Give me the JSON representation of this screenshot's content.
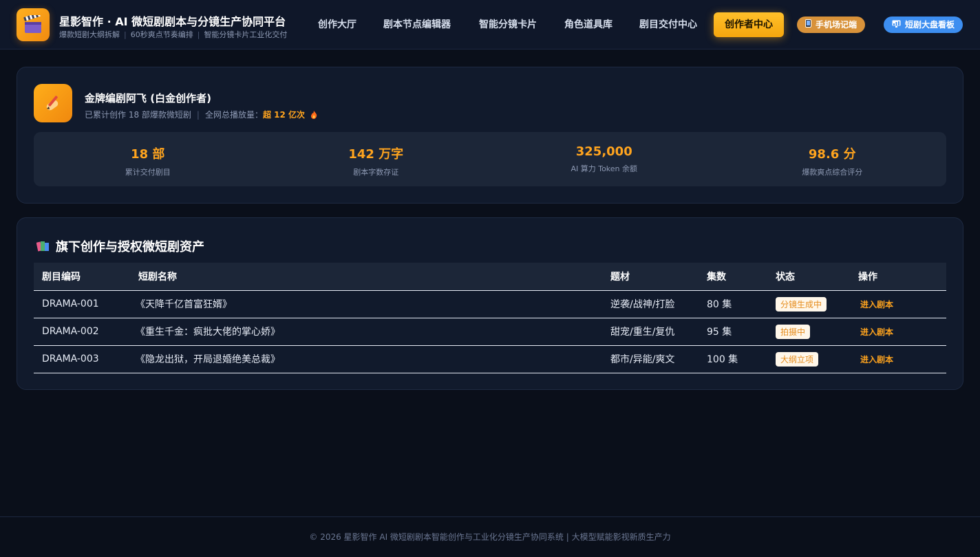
{
  "header": {
    "logo_icon": "clapperboard-icon",
    "title": "星影智作 · AI 微短剧剧本与分镜生产协同平台",
    "subtitle": [
      "爆款短剧大纲拆解",
      "60秒爽点节奏编排",
      "智能分镜卡片工业化交付"
    ],
    "nav": [
      {
        "label": "创作大厅",
        "active": false
      },
      {
        "label": "剧本节点编辑器",
        "active": false
      },
      {
        "label": "智能分镜卡片",
        "active": false
      },
      {
        "label": "角色道具库",
        "active": false
      },
      {
        "label": "剧目交付中心",
        "active": false
      },
      {
        "label": "创作者中心",
        "active": true
      }
    ],
    "phone_button": {
      "icon": "phone-icon",
      "label": "手机场记端"
    },
    "board_button": {
      "icon": "dashboard-icon",
      "label": "短剧大盘看板"
    }
  },
  "profile": {
    "avatar_icon": "writing-hand-icon",
    "name": "金牌编剧阿飞 (白金创作者)",
    "works_text": "已累计创作 18 部爆款微短剧",
    "views_label": "全网总播放量：",
    "views_value": "超 12 亿次",
    "stats": [
      {
        "value": "18 部",
        "label": "累计交付剧目"
      },
      {
        "value": "142 万字",
        "label": "剧本字数存证"
      },
      {
        "value": "325,000",
        "label": "AI 算力 Token 余额"
      },
      {
        "value": "98.6 分",
        "label": "爆款爽点综合评分"
      }
    ]
  },
  "assets": {
    "title_icon": "books-icon",
    "title": "旗下创作与授权微短剧资产",
    "columns": [
      "剧目编码",
      "短剧名称",
      "题材",
      "集数",
      "状态",
      "操作"
    ],
    "rows": [
      {
        "code": "DRAMA-001",
        "name": "《天降千亿首富狂婿》",
        "genre": "逆袭/战神/打脸",
        "episodes": "80 集",
        "status": "分镜生成中",
        "action": "进入剧本"
      },
      {
        "code": "DRAMA-002",
        "name": "《重生千金：疯批大佬的掌心娇》",
        "genre": "甜宠/重生/复仇",
        "episodes": "95 集",
        "status": "拍摄中",
        "action": "进入剧本"
      },
      {
        "code": "DRAMA-003",
        "name": "《隐龙出狱，开局退婚绝美总裁》",
        "genre": "都市/异能/爽文",
        "episodes": "100 集",
        "status": "大纲立项",
        "action": "进入剧本"
      }
    ]
  },
  "footer": {
    "text": "© 2026 星影智作 AI 微短剧剧本智能创作与工业化分镜生产协同系统 | 大模型赋能影视新质生产力"
  },
  "colors": {
    "accent": "#ffa41e",
    "background": "#0a0f1a",
    "card": "#111a2c",
    "board_button": "#3d8ef0",
    "phone_button": "#d8923a"
  }
}
